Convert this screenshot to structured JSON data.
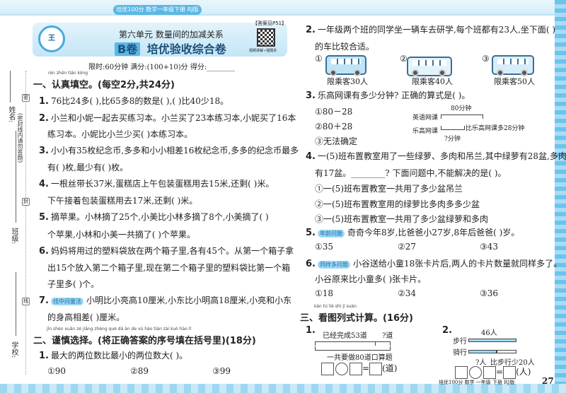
{
  "header": {
    "badge": "培优100分  数学一年级下册  RJ版",
    "answer_ref": "【答案见P51】",
    "logo_text": "王朝霞",
    "unit": "第六单元  数量间的加减关系",
    "paper_label": "B卷",
    "paper_title": "培优验收综合卷",
    "qr_caption": "视频讲解+错题本",
    "meta": "限时:60分钟   满分:(100+10)分   得分:________"
  },
  "side": {
    "name": "姓名:",
    "class": "班级:",
    "school": "学校:",
    "notice": "(密封线内请勿答题)",
    "seal": "密",
    "seal2": "封",
    "seal3": "线"
  },
  "s1": {
    "pinyin": "rèn zhēn tián kòng",
    "title": "一、认真填空。(每空2分,共24分)",
    "q": [
      {
        "n": "1.",
        "lines": [
          "76比24多(        ),比65多8的数是(        ),(        )比40少18。"
        ]
      },
      {
        "n": "2.",
        "lines": [
          "小兰和小妮一起去买练习本。小兰买了23本练习本,小妮买了16本",
          "练习本。小妮比小兰少买(        )本练习本。"
        ]
      },
      {
        "n": "3.",
        "lines": [
          "小小有35枚纪念币,多多和小小相差16枚纪念币,多多的纪念币最多",
          "有(        )枚,最少有(        )枚。"
        ]
      },
      {
        "n": "4.",
        "lines": [
          "一根丝带长37米,蛋糕店上午包装蛋糕用去15米,还剩(        )米。",
          "下午接着包装蛋糕用去17米,还剩(        )米。"
        ]
      },
      {
        "n": "5.",
        "lines": [
          "摘苹果。小林摘了25个,小美比小林多摘了8个,小美摘了(        )",
          "个苹果,小林和小美一共摘了(        )个苹果。"
        ]
      },
      {
        "n": "6.",
        "lines": [
          "妈妈将用过的塑料袋放在两个箱子里,各有45个。从第一个箱子拿",
          "出15个放入第二个箱子里,现在第二个箱子里的塑料袋比第一个箱",
          "子里多(        )个。"
        ]
      },
      {
        "n": "7.",
        "tag": "找中间量法",
        "lines": [
          "小明比小亮高10厘米,小东比小明高18厘米,小亮和小东",
          "的身高相差(        )厘米。"
        ]
      }
    ]
  },
  "s2": {
    "pinyin": "jǐn shèn xuǎn zé      jiāng zhèng què dá àn de xù hào tián zài kuò hào lǐ",
    "title": "二、谨慎选择。(将正确答案的序号填在括号里)(18分)",
    "q1": {
      "n": "1.",
      "text": "最大的两位数比最小的两位数大(     )。",
      "opts": [
        "①90",
        "②89",
        "③99"
      ]
    },
    "q2": {
      "n": "2.",
      "lines": [
        "一年级两个班的同学坐一辆车去研学,每个班都有23人,坐下面(     )",
        "的车比较合适。"
      ],
      "opts": [
        "①",
        "②",
        "③"
      ],
      "caps": [
        "限乘客30人",
        "限乘客40人",
        "限乘客50人"
      ]
    },
    "q3": {
      "n": "3.",
      "text": "乐高网课有多少分钟? 正确的算式是(     )。",
      "opts": [
        "①80－28",
        "②80＋28",
        "③无法确定"
      ],
      "diagram": {
        "total": "80分钟",
        "a": "英语网课",
        "b": "乐高网课",
        "diff": "比乐高网课多28分钟",
        "q": "?分钟"
      }
    },
    "q4": {
      "n": "4.",
      "lines": [
        "一(5)班布置教室用了一些绿萝、多肉和吊兰,其中绿萝有28盆,多肉",
        "有17盆。________? 下面问题中,不能解决的是(     )。"
      ],
      "opts": [
        "①一(5)班布置教室一共用了多少盆吊兰",
        "②一(5)班布置教室用的绿萝比多肉多多少盆",
        "③一(5)班布置教室一共用了多少盆绿萝和多肉"
      ]
    },
    "q5": {
      "n": "5.",
      "tag": "年龄问题",
      "text": "奇奇今年8岁,比爸爸小27岁,8年后爸爸(     )岁。",
      "opts": [
        "①35",
        "②27",
        "③43"
      ]
    },
    "q6": {
      "n": "6.",
      "tag": "同样多问题",
      "lines": [
        "小谷送给小童18张卡片后,两人的卡片数量就同样多了。",
        "小谷原来比小童多(     )张卡片。"
      ],
      "opts": [
        "①18",
        "②34",
        "③36"
      ]
    }
  },
  "s3": {
    "pinyin": "kàn tú liè shì jì suàn",
    "title": "三、看图列式计算。(16分)",
    "q1": {
      "n": "1.",
      "done": "已经完成53道",
      "q": "?道",
      "total": "一共要做80道口算题",
      "eq": "=",
      "unit": "(道)"
    },
    "q2": {
      "n": "2.",
      "total": "46人",
      "walk": "步行",
      "ride": "骑行",
      "q": "?人",
      "diff": "比步行少20人",
      "eq": "=",
      "unit": "(人)"
    }
  },
  "footer": {
    "text": "培优100分   数学   一年级   下册   RJ版",
    "page": "27"
  }
}
